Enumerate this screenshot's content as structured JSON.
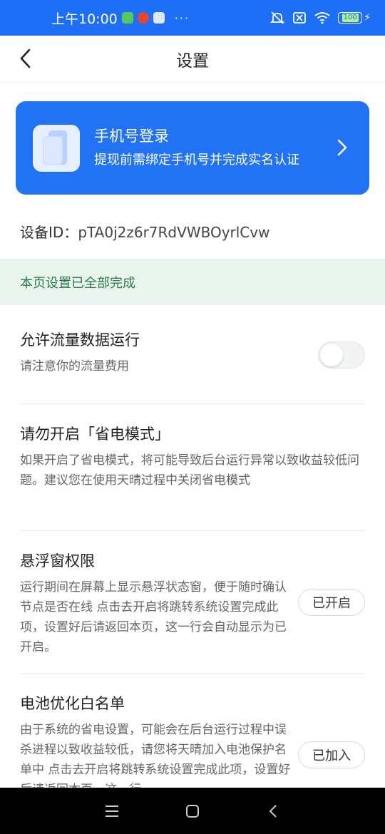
{
  "status_bar": {
    "time": "上午10:00",
    "dots": "···",
    "battery": "100"
  },
  "header": {
    "title": "设置"
  },
  "login_card": {
    "title": "手机号登录",
    "subtitle": "提现前需绑定手机号并完成实名认证"
  },
  "device": {
    "label": "设备ID：",
    "value": "pTA0j2z6r7RdVWBOyrlCvw"
  },
  "banner": {
    "text": "本页设置已全部完成"
  },
  "settings": [
    {
      "title": "允许流量数据运行",
      "desc": "请注意你的流量费用",
      "toggle_on": false
    },
    {
      "title": "请勿开启「省电模式」",
      "desc": "如果开启了省电模式，将可能导致后台运行异常以致收益较低问题。建议您在使用天晴过程中关闭省电模式"
    },
    {
      "title": "悬浮窗权限",
      "desc": "运行期间在屏幕上显示悬浮状态窗，便于随时确认节点是否在线 点击去开启将跳转系统设置完成此项，设置好后请返回本页，这一行会自动显示为已开启。",
      "button": "已开启"
    },
    {
      "title": "电池优化白名单",
      "desc": "由于系统的省电设置，可能会在后台运行过程中误杀进程以致收益较低，请您将天晴加入电池保护名单中 点击去开启将跳转系统设置完成此项，设置好后请返回本页，这一行",
      "button": "已加入"
    }
  ],
  "colors": {
    "accent": "#2173f3",
    "status_bar": "#1e6ff5",
    "banner_bg": "#eaf4ee",
    "banner_text": "#2a7a4a"
  }
}
